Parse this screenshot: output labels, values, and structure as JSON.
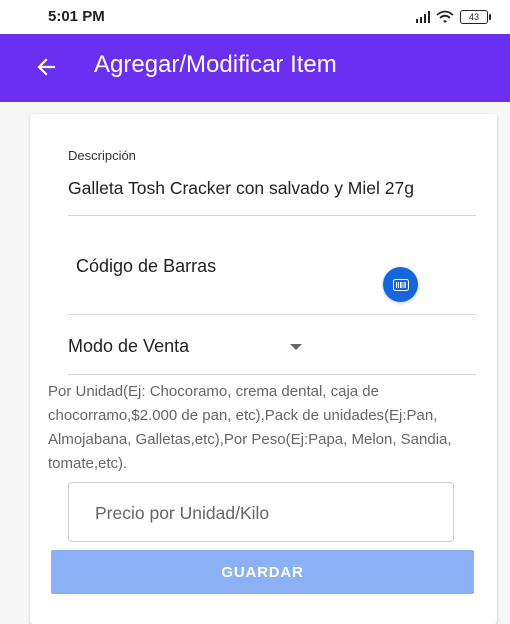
{
  "status_bar": {
    "time": "5:01 PM",
    "battery": "43",
    "icons": [
      "signal-icon",
      "wifi-icon",
      "battery-icon"
    ]
  },
  "app_bar": {
    "title": "Agregar/Modificar Item",
    "back_icon": "arrow-left-icon",
    "color": "#6a2ff0"
  },
  "form": {
    "description": {
      "label": "Descripción",
      "value": "Galleta Tosh Cracker con salvado y Miel 27g"
    },
    "barcode": {
      "label": "Código de Barras",
      "scan_icon": "barcode-icon",
      "button_color": "#1565dc"
    },
    "sale_mode": {
      "selected": "Modo de Venta",
      "arrow_icon": "dropdown-arrow-icon"
    },
    "help_text": "Por Unidad(Ej: Chocoramo, crema dental, caja de chocorramo,$2.000 de pan, etc),Pack de unidades(Ej:Pan, Almojabana, Galletas,etc),Por Peso(Ej:Papa, Melon, Sandia, tomate,etc).",
    "price": {
      "placeholder": "Precio por Unidad/Kilo",
      "value": ""
    },
    "save_label": "GUARDAR",
    "save_color": "#8bb0f3"
  }
}
